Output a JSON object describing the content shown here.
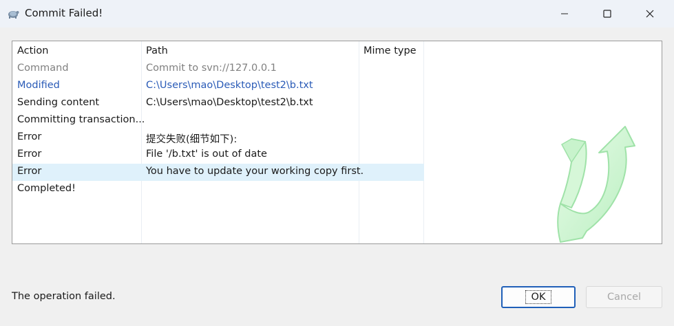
{
  "window": {
    "title": "Commit Failed!",
    "icon": "tortoisesvn-icon",
    "controls": [
      "minimize-icon",
      "maximize-icon",
      "close-icon"
    ]
  },
  "list": {
    "columns": [
      "Action",
      "Path",
      "Mime type"
    ],
    "rows": [
      {
        "action": "Command",
        "path": "Commit to svn://127.0.0.1",
        "style": "grey"
      },
      {
        "action": "Modified",
        "path": "C:\\Users\\mao\\Desktop\\test2\\b.txt",
        "style": "blue"
      },
      {
        "action": "Sending content",
        "path": "C:\\Users\\mao\\Desktop\\test2\\b.txt",
        "style": "normal"
      },
      {
        "action": "Committing transaction...",
        "path": "",
        "style": "normal"
      },
      {
        "action": "Error",
        "path": "提交失败(细节如下):",
        "style": "normal"
      },
      {
        "action": "Error",
        "path": "File '/b.txt' is out of date",
        "style": "normal"
      },
      {
        "action": "Error",
        "path": "You have to update your working copy first.",
        "style": "selected"
      },
      {
        "action": "Completed!",
        "path": "",
        "style": "normal"
      }
    ]
  },
  "status": "The operation failed.",
  "buttons": {
    "ok": "OK",
    "cancel": "Cancel"
  },
  "colors": {
    "accent": "#1f5fb8",
    "selected_row": "#dff1fb",
    "link_blue": "#2a5bb7"
  }
}
